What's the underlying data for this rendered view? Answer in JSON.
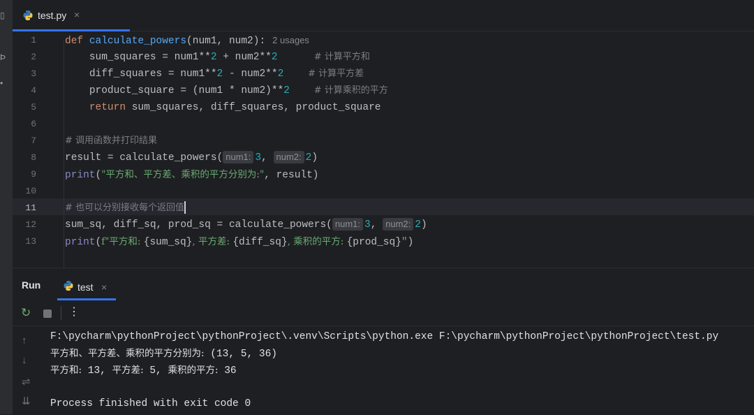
{
  "editor": {
    "tab": {
      "filename": "test.py",
      "close": "×"
    },
    "usages_hint": "2 usages",
    "line_numbers": [
      "1",
      "2",
      "3",
      "4",
      "5",
      "6",
      "7",
      "8",
      "9",
      "10",
      "11",
      "12",
      "13"
    ],
    "current_line": "11",
    "lines": {
      "l1": {
        "kw": "def",
        "fn": "calculate_powers",
        "params": "(num1, num2):"
      },
      "l2": {
        "a": "sum_squares = num1**",
        "n1": "2",
        "b": " + num2**",
        "n2": "2",
        "comment": "# 计算平方和"
      },
      "l3": {
        "a": "diff_squares = num1**",
        "n1": "2",
        "b": " - num2**",
        "n2": "2",
        "comment": "# 计算平方差"
      },
      "l4": {
        "a": "product_square = (num1 * num2)**",
        "n1": "2",
        "comment": "# 计算乘积的平方"
      },
      "l5": {
        "kw": "return",
        "rest": " sum_squares, diff_squares, product_square"
      },
      "l7": {
        "comment": "# 调用函数并打印结果"
      },
      "l8": {
        "a": "result = calculate_powers(",
        "hint1": "num1:",
        "v1": "3",
        "sep": ", ",
        "hint2": "num2:",
        "v2": "2",
        "end": ")"
      },
      "l9": {
        "bi": "print",
        "open": "(",
        "str": "\"平方和、平方差、乘积的平方分别为:\"",
        "rest": ", result)"
      },
      "l11": {
        "comment": "# 也可以分别接收每个返回值"
      },
      "l12": {
        "a": "sum_sq, diff_sq, prod_sq = calculate_powers(",
        "hint1": "num1:",
        "v1": "3",
        "sep": ", ",
        "hint2": "num2:",
        "v2": "2",
        "end": ")"
      },
      "l13": {
        "bi": "print",
        "open": "(",
        "s1": "f\"平方和: ",
        "e1": "{sum_sq}",
        "s2": ", 平方差: ",
        "e2": "{diff_sq}",
        "s3": ", 乘积的平方: ",
        "e3": "{prod_sq}",
        "s4": "\"",
        "end": ")"
      }
    }
  },
  "run_panel": {
    "title": "Run",
    "tab": {
      "label": "test",
      "close": "×"
    },
    "toolbar": {
      "rerun": "↻",
      "more": "⋮"
    },
    "side_tools": {
      "up": "↑",
      "down": "↓",
      "wrap": "⇌",
      "scroll": "⇊"
    },
    "console": {
      "command": "F:\\pycharm\\pythonProject\\pythonProject\\.venv\\Scripts\\python.exe F:\\pycharm\\pythonProject\\pythonProject\\test.py",
      "out1_cn": "平方和、平方差、乘积的平方分别为:",
      "out1_val": " (13, 5, 36)",
      "out2_a": "平方和:",
      "out2_b": " 13, ",
      "out2_c": "平方差:",
      "out2_d": " 5, ",
      "out2_e": "乘积的平方:",
      "out2_f": " 36",
      "exit": "Process finished with exit code 0"
    }
  }
}
